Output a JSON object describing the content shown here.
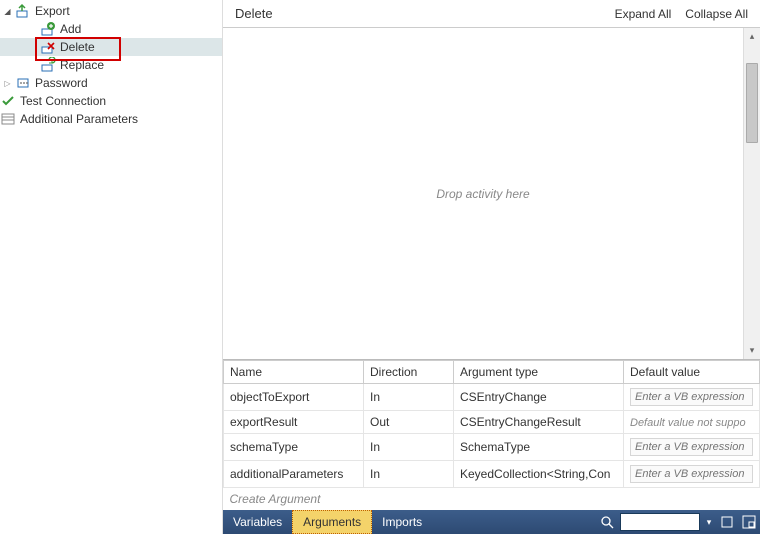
{
  "tree": {
    "export": "Export",
    "add": "Add",
    "delete": "Delete",
    "replace": "Replace",
    "password": "Password",
    "test_connection": "Test Connection",
    "additional_parameters": "Additional Parameters"
  },
  "designer": {
    "title": "Delete",
    "expand_all": "Expand All",
    "collapse_all": "Collapse All",
    "drop_hint": "Drop activity here"
  },
  "args": {
    "headers": {
      "name": "Name",
      "direction": "Direction",
      "type": "Argument type",
      "default": "Default value"
    },
    "rows": [
      {
        "name": "objectToExport",
        "direction": "In",
        "type": "CSEntryChange",
        "default_placeholder": "Enter a VB expression",
        "editable": true
      },
      {
        "name": "exportResult",
        "direction": "Out",
        "type": "CSEntryChangeResult",
        "default_text": "Default value not suppo",
        "editable": false
      },
      {
        "name": "schemaType",
        "direction": "In",
        "type": "SchemaType",
        "default_placeholder": "Enter a VB expression",
        "editable": true
      },
      {
        "name": "additionalParameters",
        "direction": "In",
        "type": "KeyedCollection<String,Con",
        "default_placeholder": "Enter a VB expression",
        "editable": true
      }
    ],
    "create": "Create Argument"
  },
  "bottombar": {
    "variables": "Variables",
    "arguments": "Arguments",
    "imports": "Imports"
  }
}
